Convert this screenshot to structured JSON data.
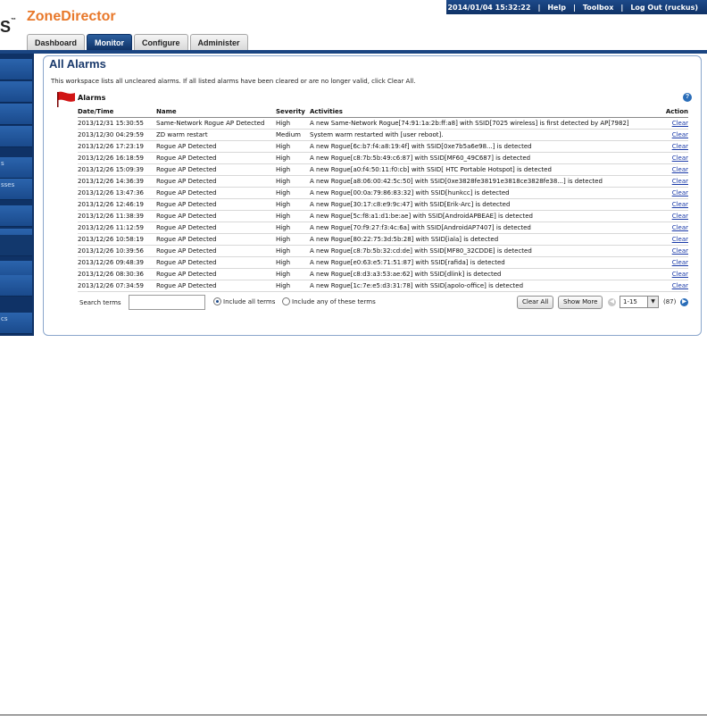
{
  "header": {
    "brand_fragment": "S",
    "app_title": "ZoneDirector",
    "datetime": "2014/01/04 15:32:22",
    "links": [
      "Help",
      "Toolbox",
      "Log Out (ruckus)"
    ]
  },
  "tabs": [
    "Dashboard",
    "Monitor",
    "Configure",
    "Administer"
  ],
  "active_tab": "Monitor",
  "sidebar": {
    "items": [
      "",
      "",
      "",
      "",
      "s",
      "sses",
      "",
      "",
      "",
      "",
      "",
      "cs"
    ],
    "selected_index": 8
  },
  "panel": {
    "title": "All Alarms",
    "description": "This workspace lists all uncleared alarms. If all listed alarms have been cleared or are no longer valid, click Clear All.",
    "section_label": "Alarms"
  },
  "table": {
    "columns": [
      "Date/Time",
      "Name",
      "Severity",
      "Activities",
      "Action"
    ],
    "rows": [
      {
        "datetime": "2013/12/31 15:30:55",
        "name": "Same-Network Rogue AP Detected",
        "severity": "High",
        "activity": "A new Same-Network Rogue[74:91:1a:2b:ff:a8] with SSID[7025 wireless] is first detected by AP[7982]",
        "action": "Clear"
      },
      {
        "datetime": "2013/12/30 04:29:59",
        "name": "ZD warm restart",
        "severity": "Medium",
        "activity": "System warm restarted with [user reboot].",
        "action": "Clear"
      },
      {
        "datetime": "2013/12/26 17:23:19",
        "name": "Rogue AP Detected",
        "severity": "High",
        "activity": "A new Rogue[6c:b7:f4:a8:19:4f] with SSID[0xe7b5a6e98...] is detected",
        "action": "Clear"
      },
      {
        "datetime": "2013/12/26 16:18:59",
        "name": "Rogue AP Detected",
        "severity": "High",
        "activity": "A new Rogue[c8:7b:5b:49:c6:87] with SSID[MF60_49C687] is detected",
        "action": "Clear"
      },
      {
        "datetime": "2013/12/26 15:09:39",
        "name": "Rogue AP Detected",
        "severity": "High",
        "activity": "A new Rogue[a0:f4:50:11:f0:cb] with SSID[ HTC Portable Hotspot] is detected",
        "action": "Clear"
      },
      {
        "datetime": "2013/12/26 14:36:39",
        "name": "Rogue AP Detected",
        "severity": "High",
        "activity": "A new Rogue[a8:06:00:42:5c:50] with SSID[0xe3828fe38191e3818ce3828fe38...] is detected",
        "action": "Clear"
      },
      {
        "datetime": "2013/12/26 13:47:36",
        "name": "Rogue AP Detected",
        "severity": "High",
        "activity": "A new Rogue[00:0a:79:86:83:32] with SSID[hunkcc] is detected",
        "action": "Clear"
      },
      {
        "datetime": "2013/12/26 12:46:19",
        "name": "Rogue AP Detected",
        "severity": "High",
        "activity": "A new Rogue[30:17:c8:e9:9c:47] with SSID[Erik-Arc] is detected",
        "action": "Clear"
      },
      {
        "datetime": "2013/12/26 11:38:39",
        "name": "Rogue AP Detected",
        "severity": "High",
        "activity": "A new Rogue[5c:f8:a1:d1:be:ae] with SSID[AndroidAPBEAE] is detected",
        "action": "Clear"
      },
      {
        "datetime": "2013/12/26 11:12:59",
        "name": "Rogue AP Detected",
        "severity": "High",
        "activity": "A new Rogue[70:f9:27:f3:4c:6a] with SSID[AndroidAP7407] is detected",
        "action": "Clear"
      },
      {
        "datetime": "2013/12/26 10:58:19",
        "name": "Rogue AP Detected",
        "severity": "High",
        "activity": "A new Rogue[80:22:75:3d:5b:28] with SSID[iala] is detected",
        "action": "Clear"
      },
      {
        "datetime": "2013/12/26 10:39:56",
        "name": "Rogue AP Detected",
        "severity": "High",
        "activity": "A new Rogue[c8:7b:5b:32:cd:de] with SSID[MF80_32CDDE] is detected",
        "action": "Clear"
      },
      {
        "datetime": "2013/12/26 09:48:39",
        "name": "Rogue AP Detected",
        "severity": "High",
        "activity": "A new Rogue[e0:63:e5:71:51:87] with SSID[rafida] is detected",
        "action": "Clear"
      },
      {
        "datetime": "2013/12/26 08:30:36",
        "name": "Rogue AP Detected",
        "severity": "High",
        "activity": "A new Rogue[c8:d3:a3:53:ae:62] with SSID[dlink] is detected",
        "action": "Clear"
      },
      {
        "datetime": "2013/12/26 07:34:59",
        "name": "Rogue AP Detected",
        "severity": "High",
        "activity": "A new Rogue[1c:7e:e5:d3:31:78] with SSID[apolo-office] is detected",
        "action": "Clear"
      }
    ]
  },
  "search": {
    "label": "Search terms",
    "value": "",
    "option_all": "Include all terms",
    "option_any": "Include any of these terms",
    "selected_option": "all"
  },
  "buttons": {
    "clear_all": "Clear All",
    "show_more": "Show More"
  },
  "pagination": {
    "range": "1-15",
    "total": "(87)"
  },
  "colors": {
    "brand_orange": "#e8782a",
    "nav_blue": "#0f3266",
    "link_blue": "#1a3aa8"
  }
}
